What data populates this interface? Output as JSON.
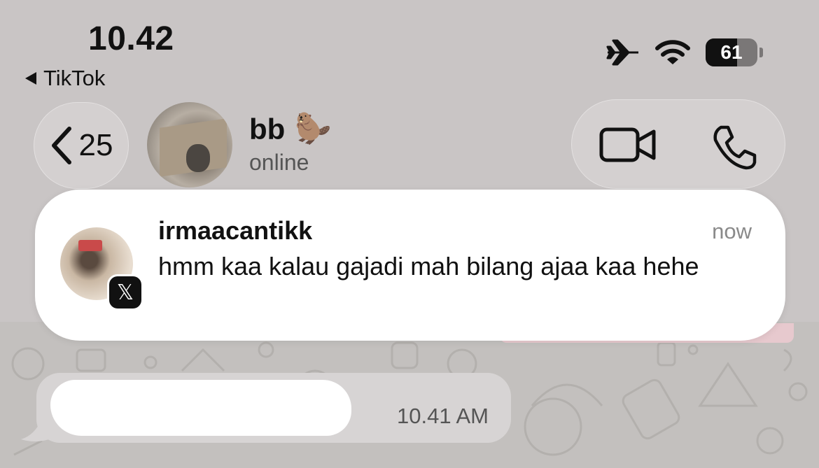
{
  "status_bar": {
    "time": "10.42",
    "back_app": "TikTok",
    "battery": "61",
    "battery_level": 0.61,
    "icons": [
      "airplane-icon",
      "wifi-icon",
      "battery-icon"
    ]
  },
  "chat_header": {
    "unread_count": "25",
    "contact_name": "bb",
    "contact_emoji": "🦫",
    "contact_status": "online",
    "icons": [
      "chevron-left-icon",
      "video-call-icon",
      "phone-call-icon"
    ]
  },
  "notification": {
    "app_icon": "x-app-icon",
    "sender": "irmaacantikk",
    "time": "now",
    "message": "hmm kaa kalau gajadi mah bilang ajaa kaa hehe"
  },
  "chat": {
    "message_time": "10.41 AM"
  },
  "colors": {
    "notification_bg": "#ffffff",
    "header_bg": "#c9c5c5",
    "bubble_bg": "#d7d4d4",
    "outgoing_bubble": "#e7c9ce"
  }
}
